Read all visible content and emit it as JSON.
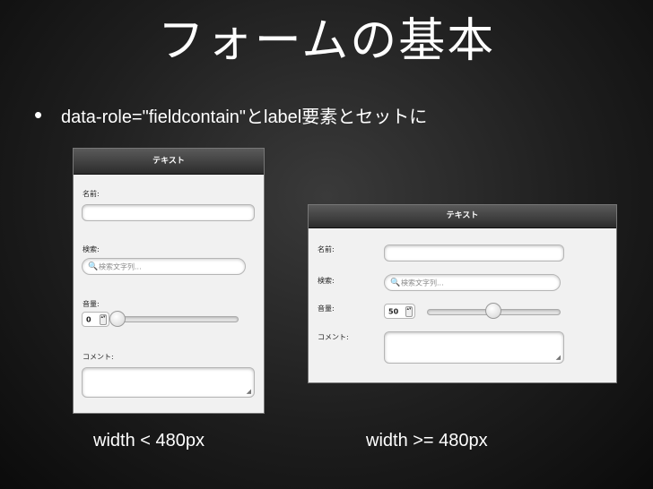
{
  "slide": {
    "title": "フォームの基本",
    "bullet": "data-role=\"fieldcontain\"とlabel要素とセットに"
  },
  "narrow_panel": {
    "header": "テキスト",
    "name_label": "名前:",
    "search_label": "検索:",
    "search_placeholder": "検索文字列...",
    "volume_label": "音量:",
    "volume_value": "0",
    "slider_fraction": 0.0,
    "comment_label": "コメント:",
    "caption": "width < 480px"
  },
  "wide_panel": {
    "header": "テキスト",
    "name_label": "名前:",
    "search_label": "検索:",
    "search_placeholder": "検索文字列...",
    "volume_label": "音量:",
    "volume_value": "50",
    "slider_fraction": 0.5,
    "comment_label": "コメント:",
    "caption": "width >= 480px"
  },
  "icons": {
    "search": "magnifier-icon",
    "spinner": "spinner-icon",
    "resize": "resize-grip-icon"
  }
}
